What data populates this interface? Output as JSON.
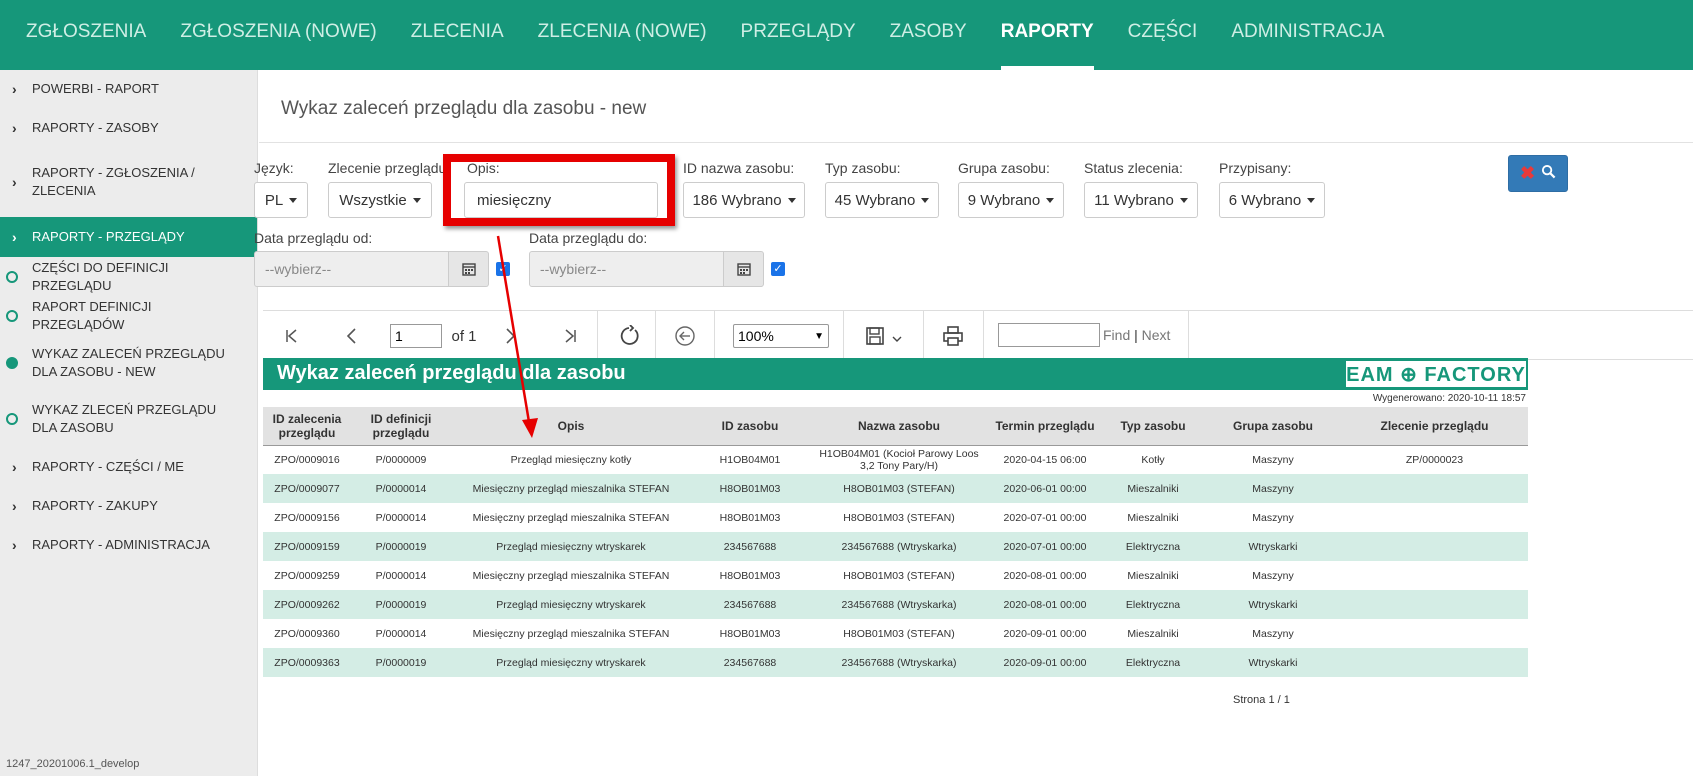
{
  "topnav": {
    "items": [
      "ZGŁOSZENIA",
      "ZGŁOSZENIA (NOWE)",
      "ZLECENIA",
      "ZLECENIA (NOWE)",
      "PRZEGLĄDY",
      "ZASOBY",
      "RAPORTY",
      "CZĘŚCI",
      "ADMINISTRACJA"
    ],
    "active": "RAPORTY"
  },
  "sidebar": {
    "items": [
      {
        "label": "POWERBI - RAPORT",
        "kind": "chevron"
      },
      {
        "label": "RAPORTY - ZASOBY",
        "kind": "chevron"
      },
      {
        "label": "RAPORTY - ZGŁOSZENIA / ZLECENIA",
        "kind": "chevron"
      },
      {
        "label": "RAPORTY - PRZEGLĄDY",
        "kind": "chevron",
        "active": true
      },
      {
        "label": "CZĘŚCI DO DEFINICJI PRZEGLĄDU",
        "kind": "circle"
      },
      {
        "label": "RAPORT DEFINICJI PRZEGLĄDÓW",
        "kind": "circle"
      },
      {
        "label": "WYKAZ ZALECEŃ PRZEGLĄDU DLA ZASOBU - NEW",
        "kind": "circle-filled"
      },
      {
        "label": "WYKAZ ZLECEŃ PRZEGLĄDU DLA ZASOBU",
        "kind": "circle"
      },
      {
        "label": "RAPORTY - CZĘŚCI / ME",
        "kind": "chevron"
      },
      {
        "label": "RAPORTY - ZAKUPY",
        "kind": "chevron"
      },
      {
        "label": "RAPORTY - ADMINISTRACJA",
        "kind": "chevron"
      }
    ],
    "version": "1247_20201006.1_develop"
  },
  "page": {
    "title": "Wykaz zaleceń przeglądu dla zasobu - new"
  },
  "filters": {
    "jezyk": {
      "label": "Język:",
      "value": "PL"
    },
    "zlecenie": {
      "label": "Zlecenie przeglądu",
      "value": "Wszystkie"
    },
    "opis": {
      "label": "Opis:",
      "value": "miesięczny"
    },
    "id_nazwa": {
      "label": "ID nazwa zasobu:",
      "value": "186 Wybrano"
    },
    "typ": {
      "label": "Typ zasobu:",
      "value": "45 Wybrano"
    },
    "grupa": {
      "label": "Grupa zasobu:",
      "value": "9 Wybrano"
    },
    "status": {
      "label": "Status zlecenia:",
      "value": "11 Wybrano"
    },
    "przypisany": {
      "label": "Przypisany:",
      "value": "6 Wybrano"
    },
    "data_od": {
      "label": "Data przeglądu od:",
      "placeholder": "--wybierz--"
    },
    "data_do": {
      "label": "Data przeglądu do:",
      "placeholder": "--wybierz--"
    }
  },
  "report_toolbar": {
    "page_value": "1",
    "page_of": "of 1",
    "zoom": "100%",
    "find": "Find",
    "sep": "|",
    "next": "Next"
  },
  "report": {
    "title": "Wykaz zaleceń przeglądu dla zasobu",
    "logo": "EAM ⊕ FACTORY",
    "generated": "Wygenerowano: 2020-10-11 18:57",
    "columns": [
      "ID zalecenia przeglądu",
      "ID definicji przeglądu",
      "Opis",
      "ID zasobu",
      "Nazwa zasobu",
      "Termin przeglądu",
      "Typ zasobu",
      "Grupa zasobu",
      "Zlecenie przeglądu"
    ],
    "rows": [
      [
        "ZPO/0009016",
        "P/0000009",
        "Przegląd miesięczny kotły",
        "H1OB04M01",
        "H1OB04M01 (Kocioł Parowy Loos 3,2 Tony Pary/H)",
        "2020-04-15 06:00",
        "Kotły",
        "Maszyny",
        "ZP/0000023"
      ],
      [
        "ZPO/0009077",
        "P/0000014",
        "Miesięczny przegląd mieszalnika STEFAN",
        "H8OB01M03",
        "H8OB01M03 (STEFAN)",
        "2020-06-01 00:00",
        "Mieszalniki",
        "Maszyny",
        ""
      ],
      [
        "ZPO/0009156",
        "P/0000014",
        "Miesięczny przegląd mieszalnika STEFAN",
        "H8OB01M03",
        "H8OB01M03 (STEFAN)",
        "2020-07-01 00:00",
        "Mieszalniki",
        "Maszyny",
        ""
      ],
      [
        "ZPO/0009159",
        "P/0000019",
        "Przegląd miesięczny wtryskarek",
        "234567688",
        "234567688 (Wtryskarka)",
        "2020-07-01 00:00",
        "Elektryczna",
        "Wtryskarki",
        ""
      ],
      [
        "ZPO/0009259",
        "P/0000014",
        "Miesięczny przegląd mieszalnika STEFAN",
        "H8OB01M03",
        "H8OB01M03 (STEFAN)",
        "2020-08-01 00:00",
        "Mieszalniki",
        "Maszyny",
        ""
      ],
      [
        "ZPO/0009262",
        "P/0000019",
        "Przegląd miesięczny wtryskarek",
        "234567688",
        "234567688 (Wtryskarka)",
        "2020-08-01 00:00",
        "Elektryczna",
        "Wtryskarki",
        ""
      ],
      [
        "ZPO/0009360",
        "P/0000014",
        "Miesięczny przegląd mieszalnika STEFAN",
        "H8OB01M03",
        "H8OB01M03 (STEFAN)",
        "2020-09-01 00:00",
        "Mieszalniki",
        "Maszyny",
        ""
      ],
      [
        "ZPO/0009363",
        "P/0000019",
        "Przegląd miesięczny wtryskarek",
        "234567688",
        "234567688 (Wtryskarka)",
        "2020-09-01 00:00",
        "Elektryczna",
        "Wtryskarki",
        ""
      ]
    ],
    "footer": "Strona 1 / 1"
  },
  "colors": {
    "accent": "#16977a",
    "highlight": "#e60000",
    "row_alt": "#d4ede5",
    "search_btn": "#337ab7"
  }
}
